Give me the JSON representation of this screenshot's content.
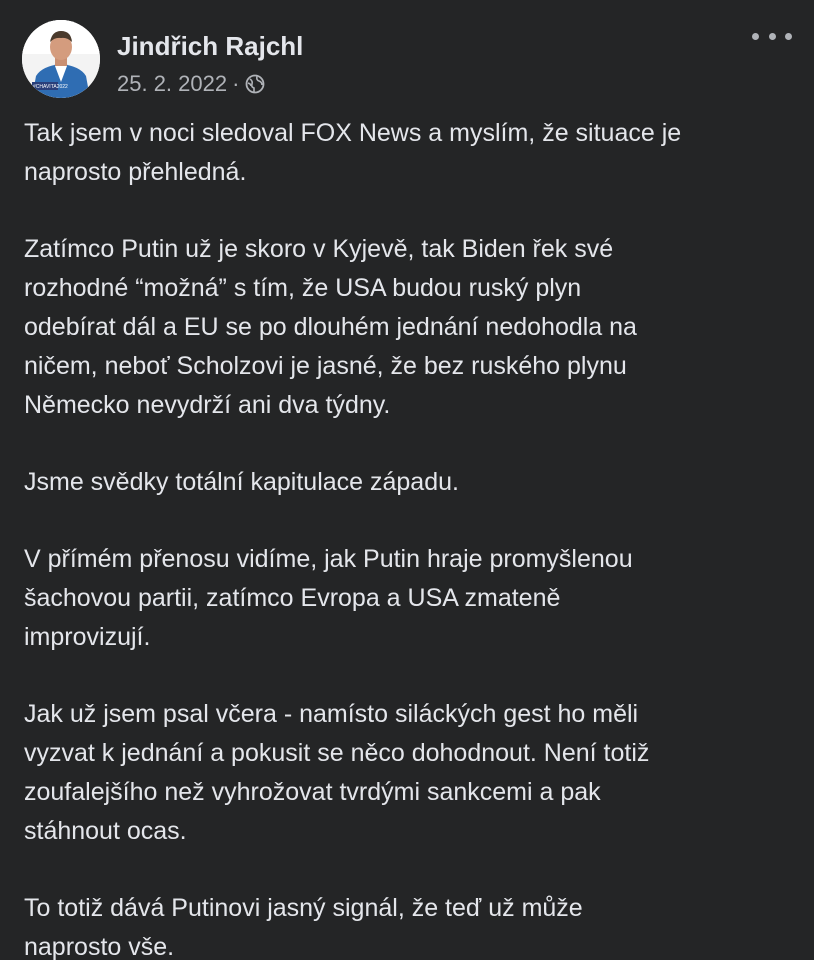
{
  "post": {
    "author": "Jindřich Rajchl",
    "avatar_badge": "#CHAVITA2022",
    "date": "25. 2. 2022",
    "separator": "·",
    "privacy_icon": "globe-icon",
    "more_icon": "more-options-icon",
    "paragraphs": [
      [
        "Tak jsem v noci sledoval FOX News a myslím, že situace je",
        "naprosto přehledná."
      ],
      [
        "Zatímco Putin už je skoro v Kyjevě, tak Biden řek své",
        "rozhodné “možná” s tím, že USA budou ruský plyn",
        "odebírat dál a EU se po dlouhém jednání nedohodla na",
        "ničem, neboť Scholzovi je jasné, že bez ruského plynu",
        "Německo nevydrží ani dva týdny."
      ],
      [
        "Jsme svědky totální kapitulace západu."
      ],
      [
        "V přímém přenosu vidíme, jak Putin hraje promyšlenou",
        "šachovou partii, zatímco Evropa a USA zmateně",
        "improvizují."
      ],
      [
        "Jak už jsem psal včera - namísto siláckých gest ho měli",
        "vyzvat k jednání a pokusit se něco dohodnout. Není totiž",
        "zoufalejšího než vyhrožovat tvrdými sankcemi a pak",
        "stáhnout ocas."
      ],
      [
        "To totiž dává Putinovi jasný signál, že teď už může",
        "naprosto vše."
      ]
    ]
  },
  "colors": {
    "background": "#242526",
    "primary_text": "#e4e6eb",
    "secondary_text": "#b0b3b8"
  }
}
